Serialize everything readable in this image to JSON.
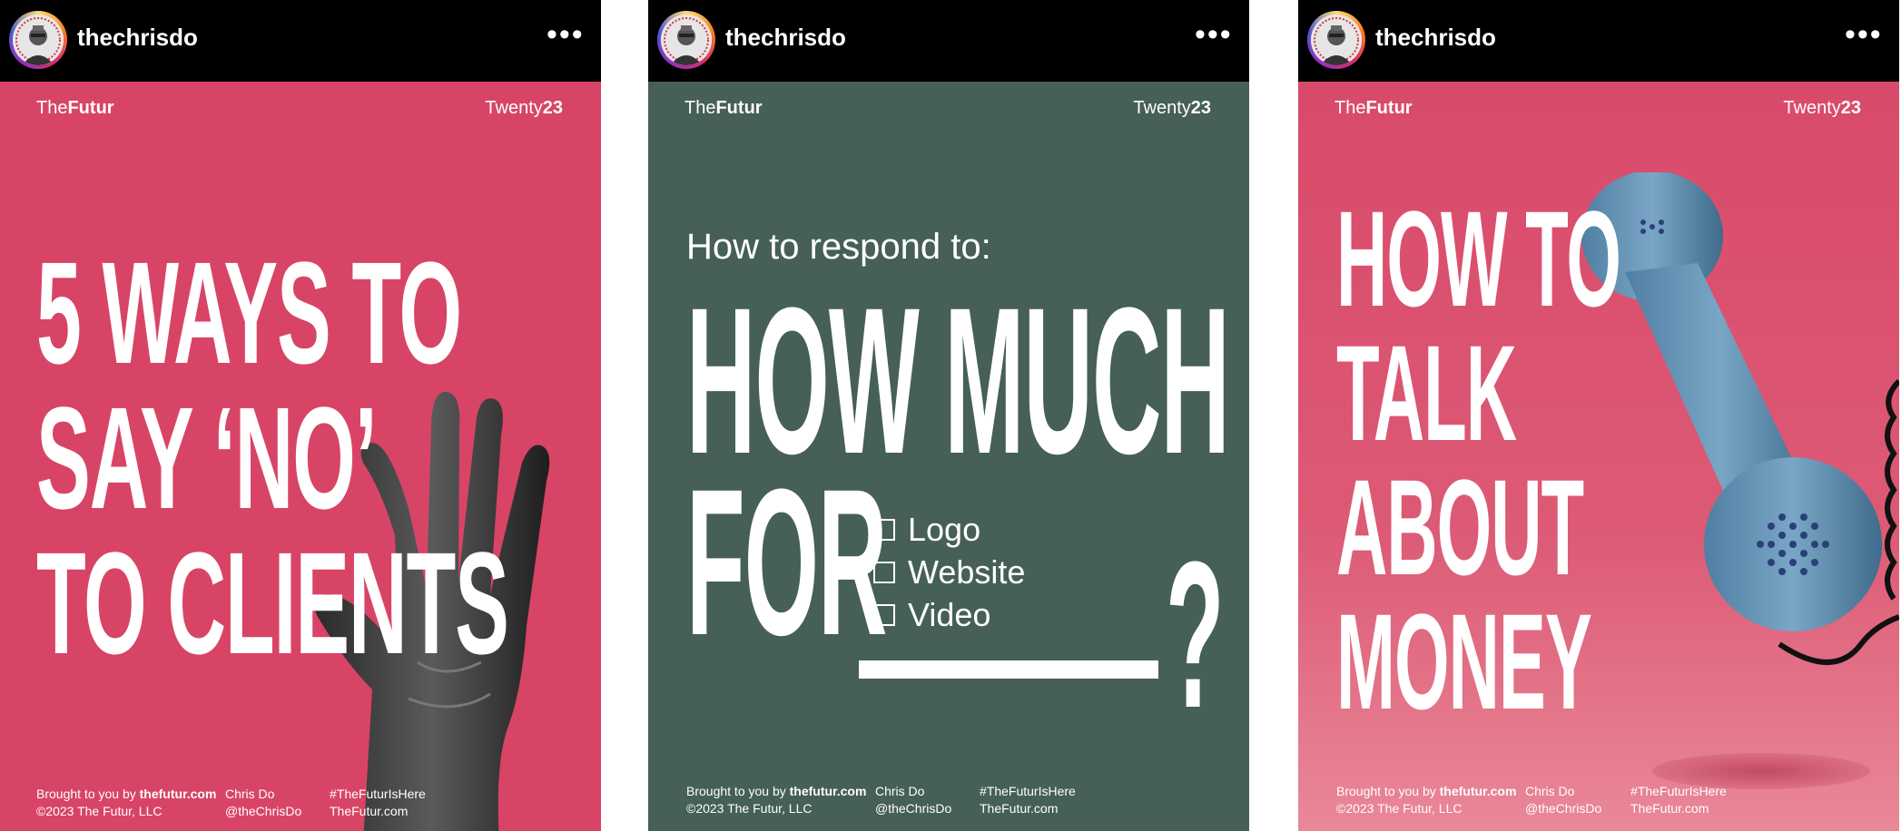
{
  "posts": [
    {
      "username": "thechrisdo",
      "brand": {
        "prefix": "The",
        "bold": "Futur"
      },
      "year": {
        "prefix": "Twenty",
        "bold": "23"
      },
      "headline": [
        "5 WAYS TO",
        "SAY ‘NO’",
        "TO CLIENTS"
      ],
      "footer": {
        "brought_prefix": "Brought to you by ",
        "brought_site": "thefutur.com",
        "copyright": "©2023 The Futur, LLC",
        "author": "Chris Do",
        "handle": "@theChrisDo",
        "hashtag": "#TheFuturIsHere",
        "site": "TheFutur.com"
      }
    },
    {
      "username": "thechrisdo",
      "brand": {
        "prefix": "The",
        "bold": "Futur"
      },
      "year": {
        "prefix": "Twenty",
        "bold": "23"
      },
      "subtitle": "How to respond to:",
      "headline": [
        "HOW MUCH",
        "FOR"
      ],
      "question_mark": "?",
      "options": [
        "Logo",
        "Website",
        "Video"
      ],
      "footer": {
        "brought_prefix": "Brought to you by ",
        "brought_site": "thefutur.com",
        "copyright": "©2023 The Futur, LLC",
        "author": "Chris Do",
        "handle": "@theChrisDo",
        "hashtag": "#TheFuturIsHere",
        "site": "TheFutur.com"
      }
    },
    {
      "username": "thechrisdo",
      "brand": {
        "prefix": "The",
        "bold": "Futur"
      },
      "year": {
        "prefix": "Twenty",
        "bold": "23"
      },
      "headline": [
        "HOW TO",
        "TALK",
        "ABOUT",
        "MONEY"
      ],
      "footer": {
        "brought_prefix": "Brought to you by ",
        "brought_site": "thefutur.com",
        "copyright": "©2023 The Futur, LLC",
        "author": "Chris Do",
        "handle": "@theChrisDo",
        "hashtag": "#TheFuturIsHere",
        "site": "TheFutur.com"
      }
    }
  ],
  "more_glyph": "•••",
  "colors": {
    "pink": "#d84466",
    "green": "#465f58",
    "phone_blue": "#6d9bbd"
  }
}
